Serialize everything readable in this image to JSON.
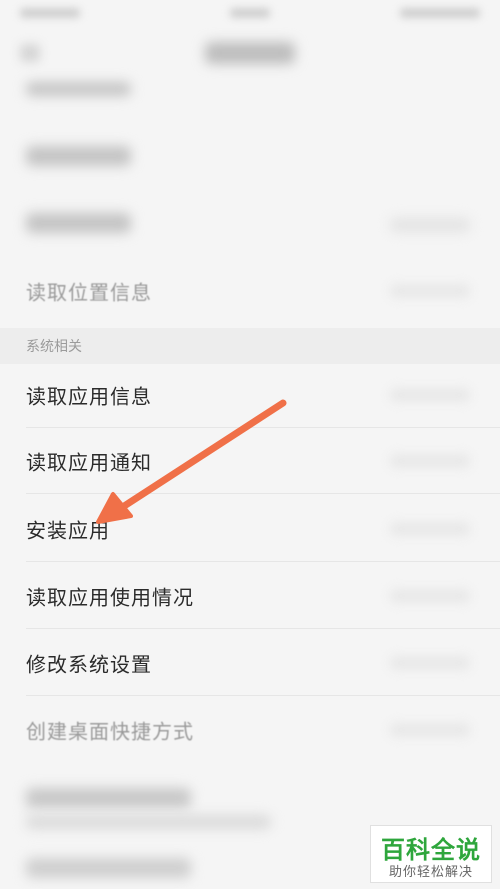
{
  "section": {
    "title": "系统相关"
  },
  "items": [
    {
      "label": "读取位置信息"
    },
    {
      "label": "读取应用信息"
    },
    {
      "label": "读取应用通知"
    },
    {
      "label": "安装应用"
    },
    {
      "label": "读取应用使用情况"
    },
    {
      "label": "修改系统设置"
    },
    {
      "label": "创建桌面快捷方式"
    }
  ],
  "watermark": {
    "brand": "百科全说",
    "slogan": "助你轻松解决"
  },
  "colors": {
    "arrow": "#f07048",
    "brand_green": "#2ea63c"
  },
  "icons": {
    "arrow": "pointer-arrow-icon"
  }
}
